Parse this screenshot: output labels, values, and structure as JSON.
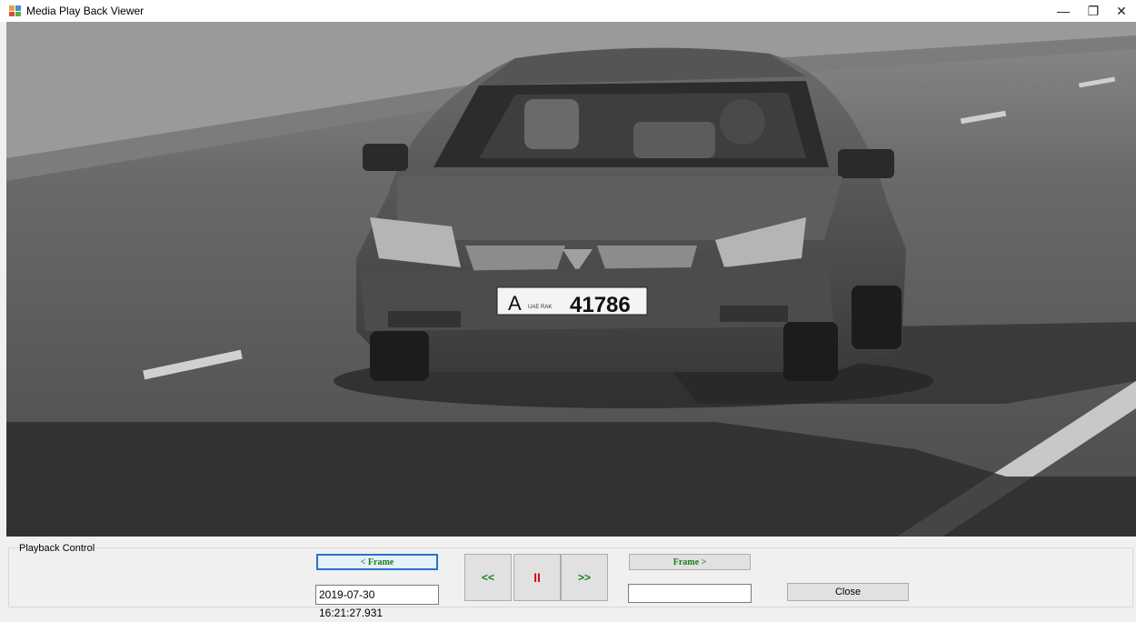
{
  "window": {
    "title": "Media Play Back Viewer",
    "controls": {
      "minimize": "—",
      "maximize": "❐",
      "close": "✕"
    }
  },
  "video": {
    "plate": {
      "letter": "A",
      "region": "UAE RAK",
      "number": "41786"
    }
  },
  "playback": {
    "group_label": "Playback Control",
    "prev_frame_label": "< Frame",
    "next_frame_label": "Frame >",
    "rewind_label": "<<",
    "pause_label": "II",
    "forward_label": ">>",
    "timestamp": "2019-07-30 16:21:27.931",
    "secondary_value": "",
    "close_label": "Close"
  },
  "colors": {
    "frame_text": "#1b7f1b",
    "pause_text": "#cc1111",
    "focus_border": "#2a72c9"
  },
  "icons": [
    "app-icon",
    "minimize-icon",
    "maximize-icon",
    "close-icon"
  ]
}
